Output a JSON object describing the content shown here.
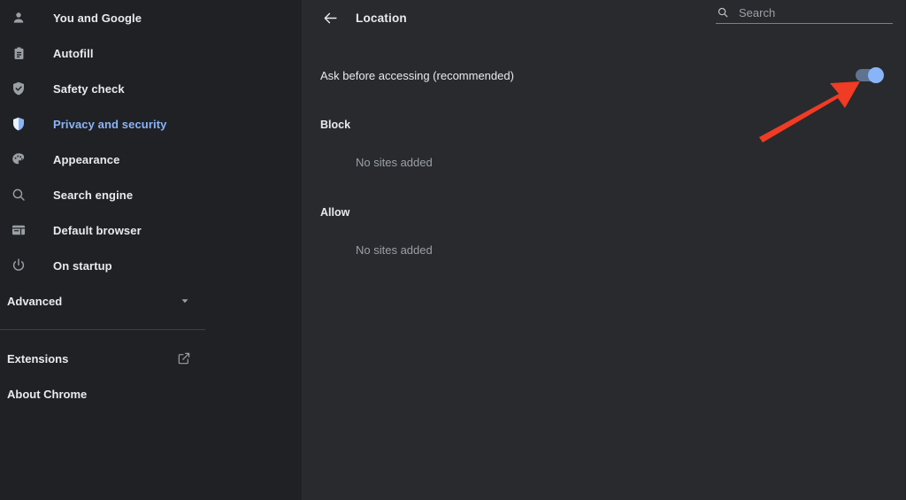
{
  "sidebar": {
    "items": [
      {
        "label": "You and Google",
        "icon": "person-icon",
        "active": false
      },
      {
        "label": "Autofill",
        "icon": "clipboard-icon",
        "active": false
      },
      {
        "label": "Safety check",
        "icon": "shield-check-icon",
        "active": false
      },
      {
        "label": "Privacy and security",
        "icon": "shield-icon",
        "active": true
      },
      {
        "label": "Appearance",
        "icon": "palette-icon",
        "active": false
      },
      {
        "label": "Search engine",
        "icon": "magnifier-icon",
        "active": false
      },
      {
        "label": "Default browser",
        "icon": "browser-window-icon",
        "active": false
      },
      {
        "label": "On startup",
        "icon": "power-icon",
        "active": false
      }
    ],
    "advanced": {
      "label": "Advanced",
      "icon": "chevron-down-icon"
    },
    "footer": [
      {
        "label": "Extensions",
        "icon": "external-link-icon"
      },
      {
        "label": "About Chrome",
        "icon": ""
      }
    ]
  },
  "header": {
    "back_icon": "arrow-left-icon",
    "title": "Location",
    "search": {
      "icon": "search-icon",
      "placeholder": "Search",
      "value": ""
    }
  },
  "main": {
    "ask": {
      "label": "Ask before accessing (recommended)",
      "toggle_on": true
    },
    "block": {
      "heading": "Block",
      "empty": "No sites added"
    },
    "allow": {
      "heading": "Allow",
      "empty": "No sites added"
    }
  },
  "annotation": {
    "type": "arrow",
    "color": "#f03b25",
    "points_to": "ask-before-accessing-toggle"
  },
  "colors": {
    "sidebar_bg": "#202124",
    "main_bg": "#292a2d",
    "accent": "#8ab4f8",
    "text": "#e8eaed",
    "muted": "#9aa0a6",
    "annotation": "#f03b25"
  }
}
